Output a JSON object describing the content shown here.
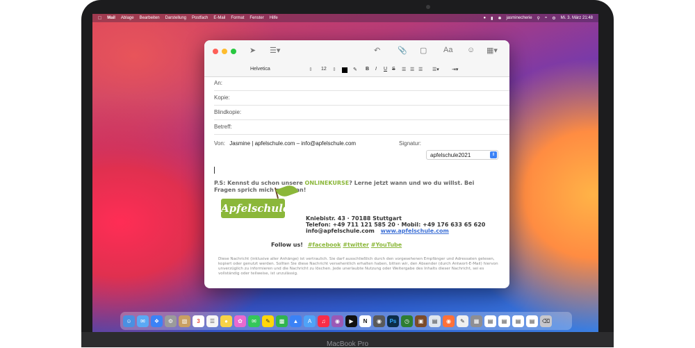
{
  "menubar": {
    "apple": "",
    "items": [
      "Mail",
      "Ablage",
      "Bearbeiten",
      "Darstellung",
      "Postfach",
      "E-Mail",
      "Format",
      "Fenster",
      "Hilfe"
    ],
    "user": "jasminecherie",
    "clock": "Mi. 3. März 21:48"
  },
  "format": {
    "font": "Helvetica",
    "size": "12",
    "bold": "B",
    "italic": "I",
    "underline": "U",
    "strike": "S"
  },
  "toolbar": {
    "aa": "Aa"
  },
  "fields": {
    "to_label": "An:",
    "cc_label": "Kopie:",
    "bcc_label": "Blindkopie:",
    "subject_label": "Betreff:",
    "from_label": "Von:",
    "from_value": "Jasmine | apfelschule.com – info@apfelschule.com",
    "signature_label": "Signatur:",
    "signature_value": "apfelschule2021"
  },
  "message": {
    "ps_prefix": "P.S: Kennst du schon unsere ",
    "ps_highlight": "ONLINEKURSE",
    "ps_suffix": "? Lerne jetzt wann und wo du willst. Bei",
    "ps_line2": "Fragen sprich mich gerne an!",
    "logo_text": "Apfelschule",
    "address": "Kniebistr. 43 · 70188 Stuttgart",
    "phone": "Telefon: +49 711 121 585 20 · Mobil: +49 176 633 65 620",
    "email": "info@apfelschule.com",
    "website": "www.apfelschule.com",
    "follow_label": "Follow us!",
    "social": [
      "#facebook",
      "#twitter",
      "#YouTube"
    ],
    "disclaimer": "Diese Nachricht (inklusive aller Anhänge) ist vertraulich. Sie darf ausschließlich durch den vorgesehenen Empfänger und Adressaten gelesen, kopiert oder genutzt werden. Sollten Sie diese Nachricht versehentlich erhalten haben, bitten wir, den Absender (durch Antwort-E-Mail) hiervon unverzüglich zu informieren und die Nachricht zu löschen. Jede unerlaubte Nutzung oder Weitergabe des Inhalts dieser Nachricht, sei es vollständig oder teilweise, ist unzulässig."
  },
  "dock": {
    "calendar_day": "3"
  },
  "device": {
    "brand": "MacBook Pro"
  },
  "colors": {
    "brand_green": "#8bb73a",
    "link_blue": "#3b6fd6",
    "traffic_red": "#fe5f57",
    "traffic_yellow": "#febc2e",
    "traffic_green": "#28c840"
  }
}
